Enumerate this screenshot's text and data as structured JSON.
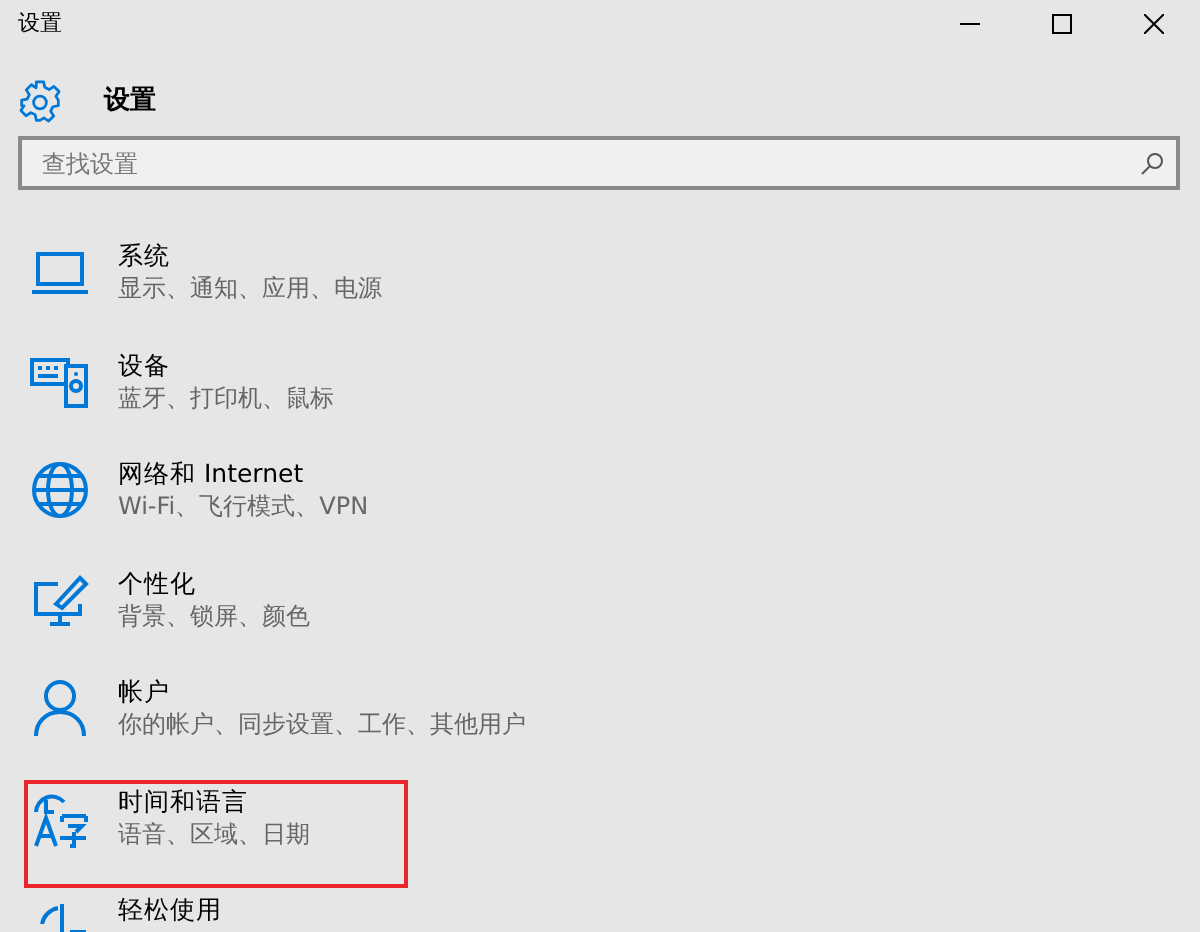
{
  "window": {
    "title": "设置"
  },
  "header": {
    "title": "设置"
  },
  "search": {
    "placeholder": "查找设置"
  },
  "categories": [
    {
      "kind": "laptop",
      "title": "系统",
      "subtitle": "显示、通知、应用、电源",
      "highlighted": false
    },
    {
      "kind": "devices",
      "title": "设备",
      "subtitle": "蓝牙、打印机、鼠标",
      "highlighted": false
    },
    {
      "kind": "globe",
      "title": "网络和 Internet",
      "subtitle": "Wi-Fi、飞行模式、VPN",
      "highlighted": false
    },
    {
      "kind": "personalize",
      "title": "个性化",
      "subtitle": "背景、锁屏、颜色",
      "highlighted": false
    },
    {
      "kind": "person",
      "title": "帐户",
      "subtitle": "你的帐户、同步设置、工作、其他用户",
      "highlighted": false
    },
    {
      "kind": "timelang",
      "title": "时间和语言",
      "subtitle": "语音、区域、日期",
      "highlighted": true
    },
    {
      "kind": "ease",
      "title": "轻松使用",
      "highlighted": false
    }
  ]
}
